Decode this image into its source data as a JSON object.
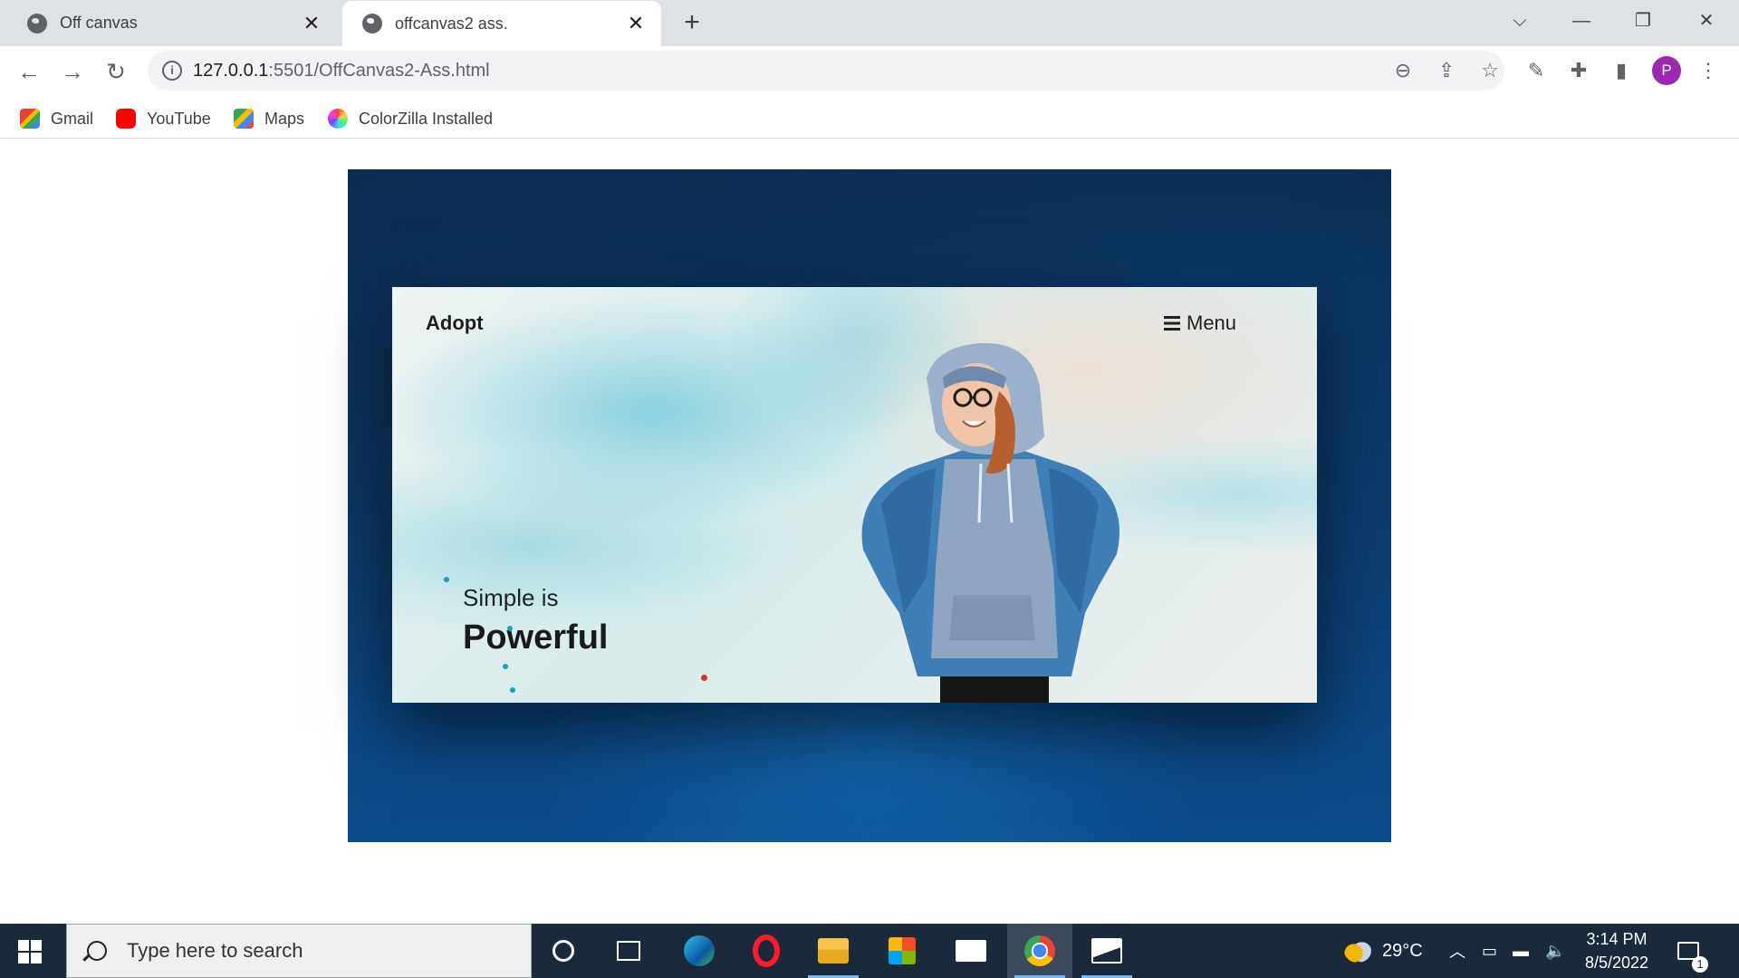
{
  "browser": {
    "tabs": [
      {
        "title": "Off canvas",
        "active": false
      },
      {
        "title": "offcanvas2 ass.",
        "active": true
      }
    ],
    "address": {
      "host": "127.0.0.1",
      "path": ":5501/OffCanvas2-Ass.html"
    },
    "bookmarks": [
      {
        "label": "Gmail",
        "icon": "gmail-icon"
      },
      {
        "label": "YouTube",
        "icon": "youtube-icon"
      },
      {
        "label": "Maps",
        "icon": "maps-icon"
      },
      {
        "label": "ColorZilla Installed",
        "icon": "colorzilla-icon"
      }
    ],
    "profile_initial": "P"
  },
  "page": {
    "brand": "Adopt",
    "menu_label": "Menu",
    "hero_subtitle": "Simple is",
    "hero_title": "Powerful"
  },
  "taskbar": {
    "search_placeholder": "Type here to search",
    "weather": "29°C",
    "time": "3:14 PM",
    "date": "8/5/2022",
    "notifications": "1"
  },
  "colors": {
    "accent_profile": "#9c27b0",
    "stage_bg": "#0b3f74",
    "taskbar_bg": "#1b2a3a"
  }
}
